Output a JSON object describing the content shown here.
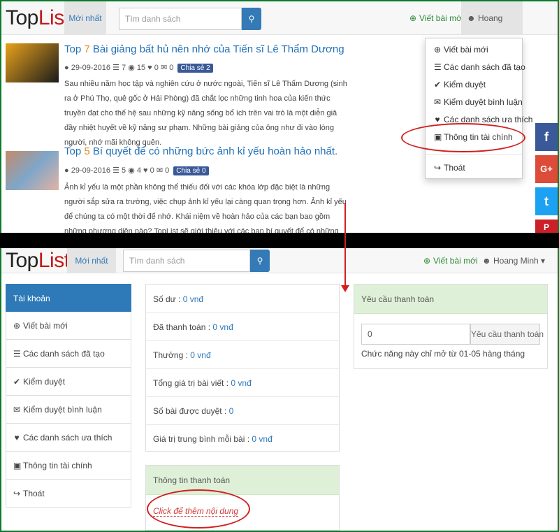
{
  "navbar": {
    "logo_top": "Top",
    "logo_list": "List",
    "newest": "Mới nhất",
    "search_placeholder": "Tìm danh sách",
    "write_post": "Viết bài mới",
    "user_name": "Hoang Minh"
  },
  "posts": [
    {
      "top_prefix": "Top ",
      "top_num": "7",
      "title": " Bài giảng bất hủ nên nhớ của Tiến sĩ Lê Thẩm Dương",
      "date": "29-09-2016",
      "lists": "7",
      "views": "15",
      "likes": "0",
      "comments": "0",
      "share": "Chia sẻ 2",
      "excerpt": "Sau nhiều năm học tập và nghiên cứu ở nước ngoài, Tiến sĩ Lê Thẩm Dương (sinh ra ở Phú Thọ, quê gốc ở Hải Phòng) đã chắt lọc những tinh hoa của kiến thức truyền đạt cho thế hệ sau những kỹ năng sống bổ ích trên vai trò là một diễn giả đầy nhiệt huyết về kỹ năng sư phạm. Những bài giảng của ông như đi vào lòng người, nhớ mãi không quên."
    },
    {
      "top_prefix": "Top ",
      "top_num": "5",
      "title": " Bí quyết để có những bức ảnh kỉ yếu hoàn hảo nhất.",
      "date": "29-09-2016",
      "lists": "5",
      "views": "4",
      "likes": "0",
      "comments": "0",
      "share": "Chia sẻ 0",
      "excerpt": "Ảnh kỉ yếu là một phần không thể thiếu đối với các khóa lớp đặc biệt là những người sắp sửa ra trường, việc chụp ảnh kỉ yếu lại càng quan trọng hơn. Ảnh kỉ yếu để chúng ta có một thời để nhớ. Khái niệm về hoàn hảo của các bạn bao gồm những phương diện nào? TopList sẽ giới thiệu với các bạn bí quyết để có những tấm ảnh kỉ yếu, độc, đẹp lạ, mang màu sắc riêng của các bạn."
    }
  ],
  "dropdown": {
    "items": [
      "Viết bài mới",
      "Các danh sách đã tạo",
      "Kiểm duyệt",
      "Kiểm duyệt bình luận",
      "Các danh sách ưa thích",
      "Thông tin tài chính"
    ],
    "logout": "Thoát"
  },
  "social": [
    "f",
    "G+",
    "t",
    "P"
  ],
  "sidebar": {
    "header": "Tài khoản",
    "items": [
      "Viết bài mới",
      "Các danh sách đã tạo",
      "Kiểm duyệt",
      "Kiểm duyệt bình luận",
      "Các danh sách ưa thích",
      "Thông tin tài chính",
      "Thoát"
    ]
  },
  "finance": {
    "rows": [
      {
        "label": "Số dư : ",
        "value": "0 vnđ"
      },
      {
        "label": "Đã thanh toán : ",
        "value": "0 vnđ"
      },
      {
        "label": "Thưởng : ",
        "value": "0 vnđ"
      },
      {
        "label": "Tổng giá trị bài viết : ",
        "value": "0 vnđ"
      },
      {
        "label": "Số bài được duyệt : ",
        "value": "0"
      },
      {
        "label": "Giá trị trung bình mỗi bài : ",
        "value": "0 vnđ"
      }
    ]
  },
  "payment_info": {
    "title": "Thông tin thanh toán",
    "link": "Click để thêm nội dung"
  },
  "payment_request": {
    "title": "Yêu cầu thanh toán",
    "input_value": "0",
    "button": "Yêu cầu thanh toán",
    "note": "Chức năng này chỉ mở từ 01-05 hàng tháng"
  },
  "colors": {
    "accent": "#337ab7",
    "green": "#2d8a36",
    "annotation": "#d02020"
  }
}
